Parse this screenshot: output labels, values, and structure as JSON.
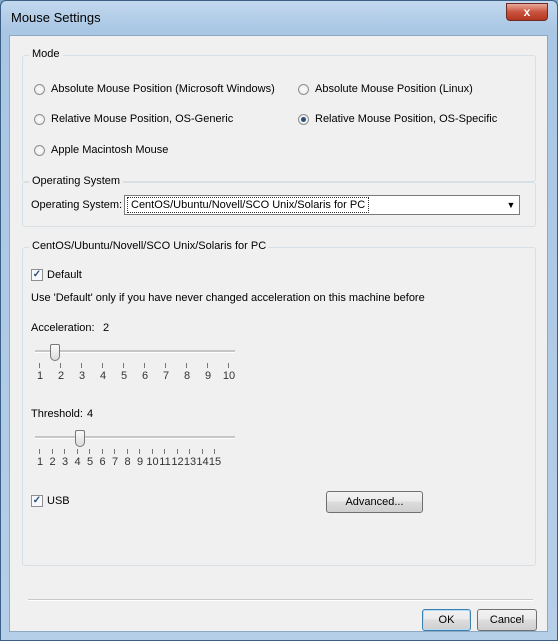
{
  "window": {
    "title": "Mouse Settings",
    "close_glyph": "x"
  },
  "mode": {
    "legend": "Mode",
    "options": [
      {
        "label": "Absolute Mouse Position (Microsoft Windows)",
        "selected": false
      },
      {
        "label": "Absolute Mouse Position (Linux)",
        "selected": false
      },
      {
        "label": "Relative Mouse Position, OS-Generic",
        "selected": false
      },
      {
        "label": "Relative Mouse Position, OS-Specific",
        "selected": true
      },
      {
        "label": "Apple Macintosh Mouse",
        "selected": false
      }
    ]
  },
  "os": {
    "legend": "Operating System",
    "label": "Operating System:",
    "selected": "CentOS/Ubuntu/Novell/SCO Unix/Solaris for PC"
  },
  "settings": {
    "legend": "CentOS/Ubuntu/Novell/SCO Unix/Solaris for PC",
    "default_label": "Default",
    "default_checked": true,
    "hint": "Use 'Default' only if you have never changed acceleration on this machine before",
    "acceleration_label": "Acceleration:",
    "acceleration_value": "2",
    "acceleration_ticks": [
      "1",
      "2",
      "3",
      "4",
      "5",
      "6",
      "7",
      "8",
      "9",
      "10"
    ],
    "threshold_label": "Threshold:",
    "threshold_value": "4",
    "threshold_ticks": [
      "1",
      "2",
      "3",
      "4",
      "5",
      "6",
      "7",
      "8",
      "9",
      "10",
      "11",
      "12",
      "13",
      "14",
      "15"
    ],
    "usb_label": "USB",
    "usb_checked": true,
    "advanced_label": "Advanced..."
  },
  "footer": {
    "ok_label": "OK",
    "cancel_label": "Cancel"
  },
  "icons": {
    "close": "close-icon",
    "dropdown": "chevron-down-icon",
    "check": "checkmark-icon"
  }
}
